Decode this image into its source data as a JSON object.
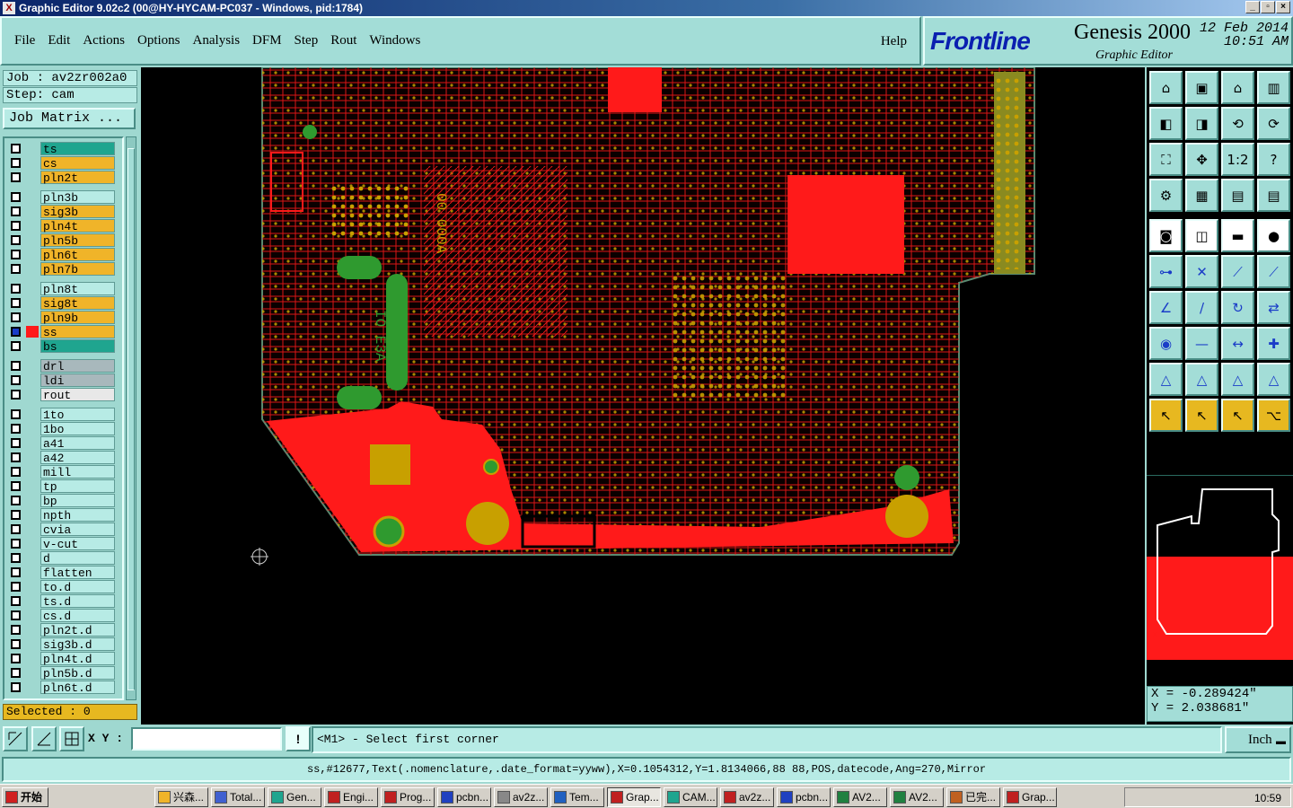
{
  "window": {
    "title": "Graphic Editor 9.02c2 (00@HY-HYCAM-PC037 - Windows, pid:1784)",
    "app_icon": "x-icon"
  },
  "menu": [
    "File",
    "Edit",
    "Actions",
    "Options",
    "Analysis",
    "DFM",
    "Step",
    "Rout",
    "Windows"
  ],
  "help_label": "Help",
  "brand": {
    "logo": "Frontline",
    "product": "Genesis 2000",
    "subtitle": "Graphic Editor",
    "date": "12 Feb 2014",
    "time": "10:51 AM"
  },
  "job": {
    "job_line": "Job : av2zr002a0",
    "step_line": "Step: cam",
    "matrix_button": "Job Matrix ..."
  },
  "layers": [
    {
      "name": "ts",
      "color": "#1fa58f"
    },
    {
      "name": "cs",
      "color": "#f0b429"
    },
    {
      "name": "pln2t",
      "color": "#f0b429"
    },
    {
      "name": "pln3b",
      "color": "#b7ebe5"
    },
    {
      "name": "sig3b",
      "color": "#f0b429"
    },
    {
      "name": "pln4t",
      "color": "#f0b429"
    },
    {
      "name": "pln5b",
      "color": "#f0b429"
    },
    {
      "name": "pln6t",
      "color": "#f0b429"
    },
    {
      "name": "pln7b",
      "color": "#f0b429"
    },
    {
      "name": "pln8t",
      "color": "#b7ebe5"
    },
    {
      "name": "sig8t",
      "color": "#f0b429"
    },
    {
      "name": "pln9b",
      "color": "#f0b429"
    },
    {
      "name": "ss",
      "color": "#f0b429",
      "active": true
    },
    {
      "name": "bs",
      "color": "#1fa58f"
    },
    {
      "name": "drl",
      "color": "#a8b8bc"
    },
    {
      "name": "ldi",
      "color": "#a8b8bc"
    },
    {
      "name": "rout",
      "color": "#e8e8e8"
    },
    {
      "name": "1to",
      "color": "#b7ebe5"
    },
    {
      "name": "1bo",
      "color": "#b7ebe5"
    },
    {
      "name": "a41",
      "color": "#b7ebe5"
    },
    {
      "name": "a42",
      "color": "#b7ebe5"
    },
    {
      "name": "mill",
      "color": "#b7ebe5"
    },
    {
      "name": "tp",
      "color": "#b7ebe5"
    },
    {
      "name": "bp",
      "color": "#b7ebe5"
    },
    {
      "name": "npth",
      "color": "#b7ebe5"
    },
    {
      "name": "cvia",
      "color": "#b7ebe5"
    },
    {
      "name": "v-cut",
      "color": "#b7ebe5"
    },
    {
      "name": "d",
      "color": "#b7ebe5"
    },
    {
      "name": "flatten",
      "color": "#b7ebe5"
    },
    {
      "name": "to.d",
      "color": "#b7ebe5"
    },
    {
      "name": "ts.d",
      "color": "#b7ebe5"
    },
    {
      "name": "cs.d",
      "color": "#b7ebe5"
    },
    {
      "name": "pln2t.d",
      "color": "#b7ebe5"
    },
    {
      "name": "sig3b.d",
      "color": "#b7ebe5"
    },
    {
      "name": "pln4t.d",
      "color": "#b7ebe5"
    },
    {
      "name": "pln5b.d",
      "color": "#b7ebe5"
    },
    {
      "name": "pln6t.d",
      "color": "#b7ebe5"
    }
  ],
  "selected_label": "Selected : 0",
  "coords": {
    "x": "X = -0.289424\"",
    "y": "Y = 2.038681\""
  },
  "cmd": {
    "xy_label": "X Y :",
    "xy_value": "",
    "prompt": "<M1> - Select first corner",
    "unit": "Inch"
  },
  "status_line": "ss,#12677,Text(.nomenclature,.date_format=yyww),X=0.1054312,Y=1.8134066,88 88,POS,datecode,Ang=270,Mirror",
  "colors": {
    "copper": "#ff1a1a",
    "pad": "#c8a000",
    "outline_green": "#2f9a2f",
    "board_edge": "#5a8a70"
  },
  "taskbar": {
    "start": "开始",
    "items": [
      "兴森...",
      "Total...",
      "Gen...",
      "Engi...",
      "Prog...",
      "pcbn...",
      "av2z...",
      "Tem...",
      "Grap...",
      "CAM...",
      "av2z...",
      "pcbn...",
      "AV2...",
      "AV2...",
      "已完...",
      "Grap..."
    ],
    "active_index": 8,
    "clock": "10:59"
  }
}
